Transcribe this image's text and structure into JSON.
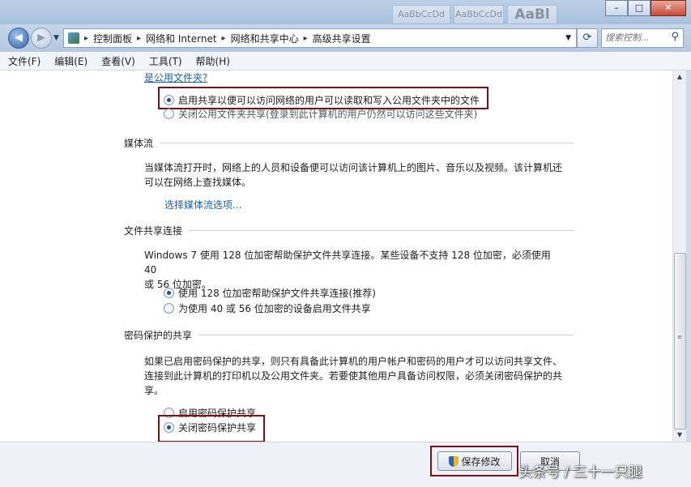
{
  "titlebar": {
    "thumbs": [
      "AaBbCcDd",
      "AaBbCcDd",
      "AaBl"
    ],
    "minimize": "–",
    "maximize": "□",
    "close": "✕"
  },
  "nav": {
    "back_icon": "back-arrow-icon",
    "forward_icon": "forward-arrow-icon",
    "breadcrumbs": [
      "控制面板",
      "网络和 Internet",
      "网络和共享中心",
      "高级共享设置"
    ],
    "search_placeholder": "搜索控制..."
  },
  "menu": [
    "文件(F)",
    "编辑(E)",
    "查看(V)",
    "工具(T)",
    "帮助(H)"
  ],
  "public_folder": {
    "link": "是公用文件夹?",
    "options": [
      {
        "label": "启用共享以便可以访问网络的用户可以读取和写入公用文件夹中的文件",
        "selected": true
      },
      {
        "label": "关闭公用文件夹共享(登录到此计算机的用户仍然可以访问这些文件夹)",
        "selected": false
      }
    ]
  },
  "media": {
    "heading": "媒体流",
    "desc": [
      "当媒体流打开时，网络上的人员和设备便可以访问该计算机上的图片、音乐以及视频。该计算机还",
      "可以在网络上查找媒体。"
    ],
    "link": "选择媒体流选项..."
  },
  "file_sharing": {
    "heading": "文件共享连接",
    "desc": [
      "Windows 7 使用 128 位加密帮助保护文件共享连接。某些设备不支持 128 位加密，必须使用 40",
      "或 56 位加密。"
    ],
    "options": [
      {
        "label": "使用 128 位加密帮助保护文件共享连接(推荐)",
        "selected": true
      },
      {
        "label": "为使用 40 或 56 位加密的设备启用文件共享",
        "selected": false
      }
    ]
  },
  "password": {
    "heading": "密码保护的共享",
    "desc": [
      "如果已启用密码保护的共享，则只有具备此计算机的用户帐户和密码的用户才可以访问共享文件、",
      "连接到此计算机的打印机以及公用文件夹。若要使其他用户具备访问权限，必须关闭密码保护的共",
      "享。"
    ],
    "options": [
      {
        "label": "启用密码保护共享",
        "selected": false
      },
      {
        "label": "关闭密码保护共享",
        "selected": true
      }
    ]
  },
  "buttons": {
    "save": "保存修改",
    "cancel": "取消"
  },
  "watermark": "头条号 / 三十一只腿",
  "colors": {
    "highlight": "#7a1215",
    "link": "#1a5fb4"
  }
}
